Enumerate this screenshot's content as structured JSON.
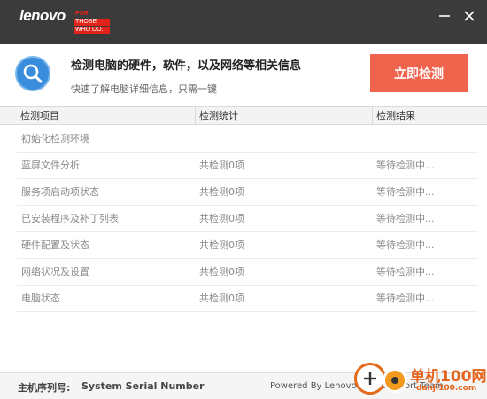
{
  "window": {
    "brand": "lenovo",
    "tagline": [
      "FOR",
      "THOSE",
      "WHO DO."
    ]
  },
  "header": {
    "title": "检测电脑的硬件，软件，以及网络等相关信息",
    "subtitle": "快速了解电脑详细信息，只需一键",
    "scan_button": "立即检测"
  },
  "table": {
    "columns": [
      "检测项目",
      "检测统计",
      "检测结果"
    ],
    "rows": [
      {
        "item": "初始化检测环境",
        "stat": "",
        "result": ""
      },
      {
        "item": "蓝屏文件分析",
        "stat": "共检测0项",
        "result": "等待检测中..."
      },
      {
        "item": "服务项启动项状态",
        "stat": "共检测0项",
        "result": "等待检测中..."
      },
      {
        "item": "已安装程序及补丁列表",
        "stat": "共检测0项",
        "result": "等待检测中..."
      },
      {
        "item": "硬件配置及状态",
        "stat": "共检测0项",
        "result": "等待检测中..."
      },
      {
        "item": "网络状况及设置",
        "stat": "共检测0项",
        "result": "等待检测中..."
      },
      {
        "item": "电脑状态",
        "stat": "共检测0项",
        "result": "等待检测中..."
      }
    ]
  },
  "footer": {
    "serial_label": "主机序列号:",
    "serial_value": "System Serial Number",
    "powered_by": "Powered By Lenovo Tech Support Team"
  },
  "watermark": {
    "name": "单机100网",
    "url": "danji100.com"
  },
  "colors": {
    "titlebar": "#3b3b3b",
    "accent": "#f0634d",
    "icon_blue": "#3a8ddc"
  },
  "icons": {
    "minimize": "minimize-icon",
    "close": "close-icon",
    "search": "magnifier-icon"
  }
}
